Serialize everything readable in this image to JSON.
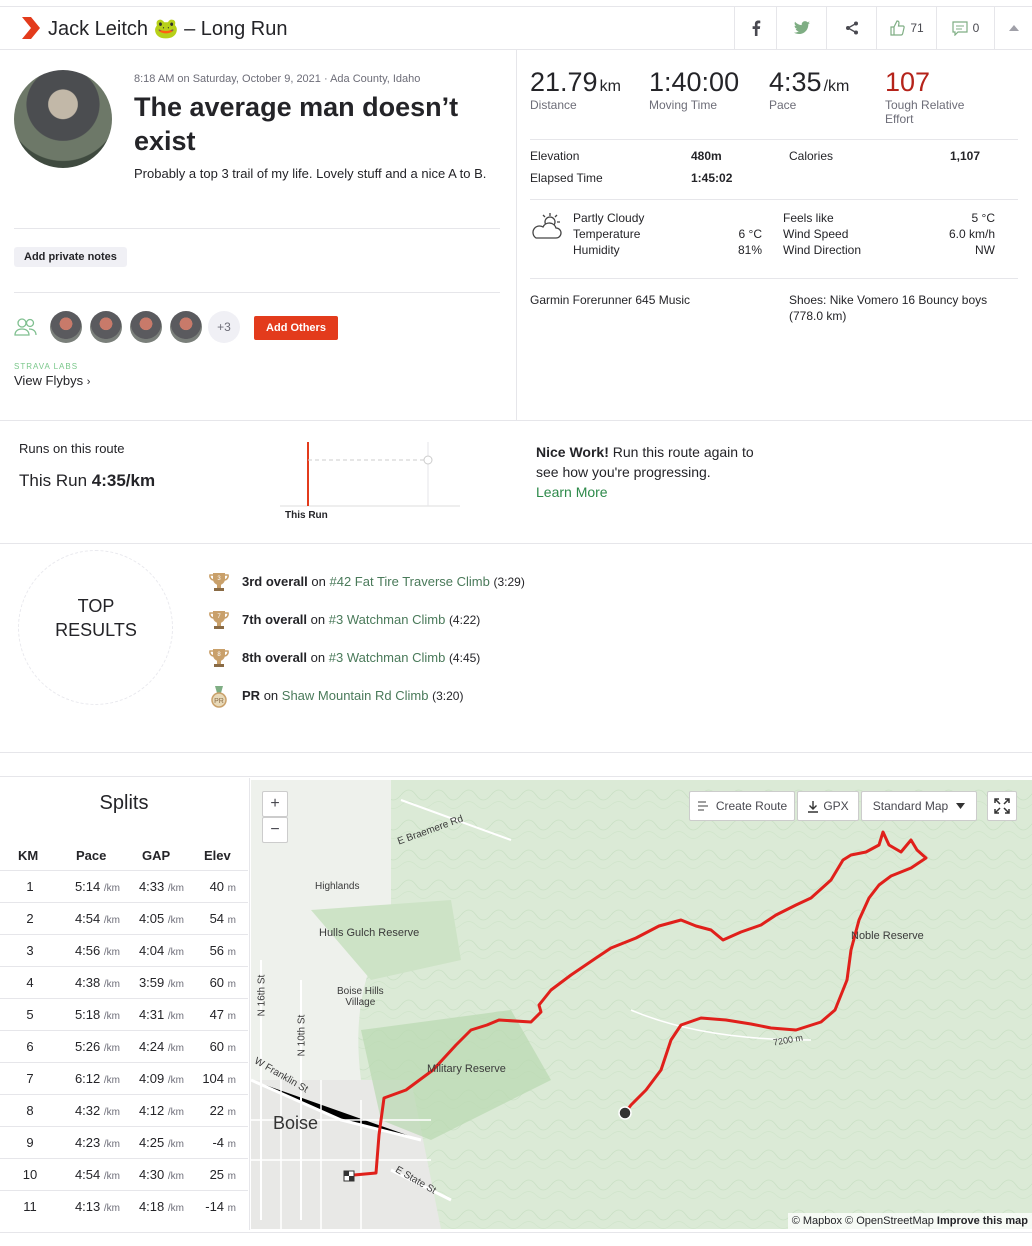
{
  "header": {
    "title": "Jack Leitch 🐸 – Long Run",
    "kudos_count": "71",
    "comments_count": "0"
  },
  "activity": {
    "meta": "8:18 AM on Saturday, October 9, 2021 · Ada County, Idaho",
    "name": "The average man doesn’t exist",
    "description": "Probably a top 3 trail of my life. Lovely stuff and a nice A to B.",
    "private_notes_label": "Add private notes",
    "athletes_more": "+3",
    "add_others_label": "Add Others",
    "labs_label": "STRAVA LABS",
    "flybys_label": "View Flybys"
  },
  "stats": {
    "distance": {
      "value": "21.79",
      "unit": "km",
      "label": "Distance"
    },
    "moving_time": {
      "value": "1:40:00",
      "label": "Moving Time"
    },
    "pace": {
      "value": "4:35",
      "unit": "/km",
      "label": "Pace"
    },
    "effort": {
      "value": "107",
      "label1": "Tough Relative",
      "label2": "Effort"
    },
    "elevation_label": "Elevation",
    "elevation": "480m",
    "calories_label": "Calories",
    "calories": "1,107",
    "elapsed_label": "Elapsed Time",
    "elapsed": "1:45:02"
  },
  "weather": {
    "condition": "Partly Cloudy",
    "temperature_label": "Temperature",
    "temperature": "6 °C",
    "humidity_label": "Humidity",
    "humidity": "81%",
    "feels_label": "Feels like",
    "feels": "5 °C",
    "wind_speed_label": "Wind Speed",
    "wind_speed": "6.0 km/h",
    "wind_dir_label": "Wind Direction",
    "wind_dir": "NW"
  },
  "gear": {
    "device": "Garmin Forerunner 645 Music",
    "shoes_line1": "Shoes: Nike Vomero 16 Bouncy boys",
    "shoes_line2": "(778.0 km)"
  },
  "route": {
    "runs_label": "Runs on this route",
    "this_run_prefix": "This Run",
    "this_run_pace": "4:35/km",
    "chart_label": "This Run",
    "nice_bold": "Nice Work!",
    "nice_rest": " Run this route again to see how you're progressing.",
    "learn_more": "Learn More"
  },
  "top_results": {
    "title_line1": "TOP",
    "title_line2": "RESULTS",
    "items": [
      {
        "rank": "3rd overall",
        "on": "on",
        "segment": "#42 Fat Tire Traverse Climb",
        "time": "(3:29)"
      },
      {
        "rank": "7th overall",
        "on": "on",
        "segment": "#3 Watchman Climb",
        "time": "(4:22)"
      },
      {
        "rank": "8th overall",
        "on": "on",
        "segment": "#3 Watchman Climb",
        "time": "(4:45)"
      },
      {
        "rank": "PR",
        "on": "on",
        "segment": "Shaw Mountain Rd Climb",
        "time": "(3:20)"
      }
    ]
  },
  "splits": {
    "title": "Splits",
    "headers": [
      "KM",
      "Pace",
      "GAP",
      "Elev"
    ],
    "unit_pace": "/km",
    "unit_elev": "m",
    "rows": [
      {
        "km": "1",
        "pace": "5:14",
        "gap": "4:33",
        "elev": "40"
      },
      {
        "km": "2",
        "pace": "4:54",
        "gap": "4:05",
        "elev": "54"
      },
      {
        "km": "3",
        "pace": "4:56",
        "gap": "4:04",
        "elev": "56"
      },
      {
        "km": "4",
        "pace": "4:38",
        "gap": "3:59",
        "elev": "60"
      },
      {
        "km": "5",
        "pace": "5:18",
        "gap": "4:31",
        "elev": "47"
      },
      {
        "km": "6",
        "pace": "5:26",
        "gap": "4:24",
        "elev": "60"
      },
      {
        "km": "7",
        "pace": "6:12",
        "gap": "4:09",
        "elev": "104"
      },
      {
        "km": "8",
        "pace": "4:32",
        "gap": "4:12",
        "elev": "22"
      },
      {
        "km": "9",
        "pace": "4:23",
        "gap": "4:25",
        "elev": "-4"
      },
      {
        "km": "10",
        "pace": "4:54",
        "gap": "4:30",
        "elev": "25"
      },
      {
        "km": "11",
        "pace": "4:13",
        "gap": "4:18",
        "elev": "-14"
      }
    ]
  },
  "map": {
    "create_route": "Create Route",
    "gpx": "GPX",
    "map_type": "Standard Map",
    "zoom_in": "+",
    "zoom_out": "−",
    "labels": {
      "braemere": "E Braemere Rd",
      "highlands": "Highlands",
      "hulls": "Hulls Gulch Reserve",
      "boise_hills_1": "Boise Hills",
      "boise_hills_2": "Village",
      "n16": "N 16th St",
      "n10": "N 10th St",
      "franklin": "W Franklin St",
      "military": "Military Reserve",
      "boise": "Boise",
      "state": "E State St",
      "noble": "Noble Reserve",
      "contour": "7200 m"
    },
    "attribution": "© Mapbox © OpenStreetMap",
    "improve": "Improve this map"
  },
  "colors": {
    "strava_orange": "#fc4c02",
    "route_red": "#e0201b",
    "effort_red": "#b5231a"
  }
}
